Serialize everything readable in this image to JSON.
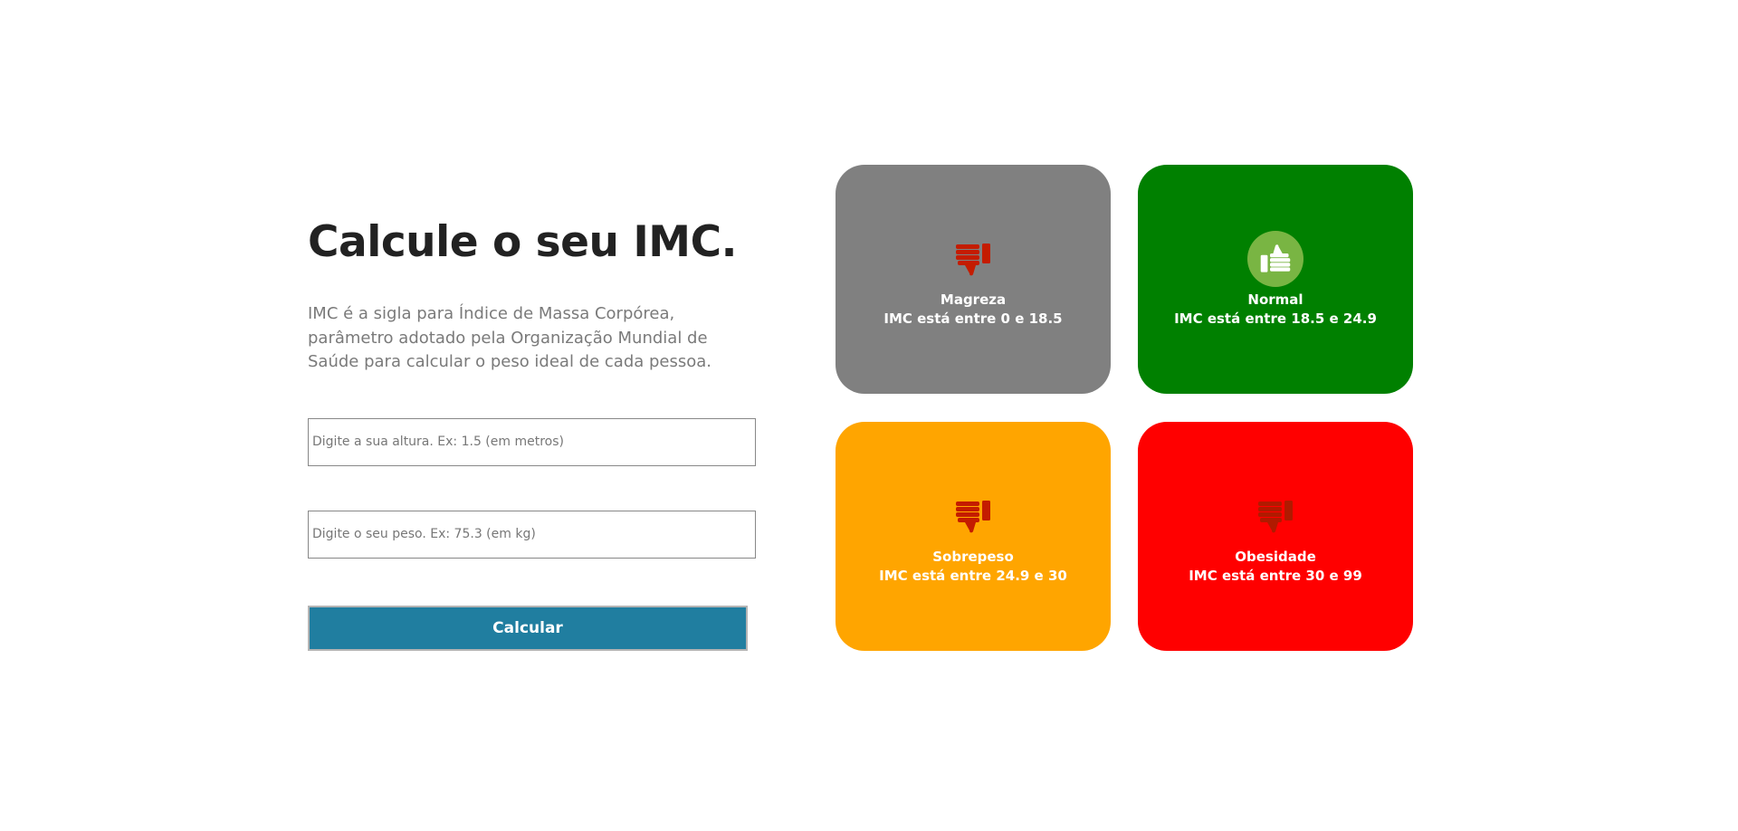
{
  "header": {
    "title": "Calcule o seu IMC.",
    "description": "IMC é a sigla para Índice de Massa Corpórea, parâmetro adotado pela Organização Mundial de Saúde para calcular o peso ideal de cada pessoa."
  },
  "form": {
    "altura_placeholder": "Digite a sua altura. Ex: 1.5 (em metros)",
    "altura_value": "",
    "peso_placeholder": "Digite o seu peso. Ex: 75.3 (em kg)",
    "peso_value": "",
    "calcular_label": "Calcular"
  },
  "cards": [
    {
      "label": "Magreza",
      "range": "IMC está entre 0 e 18.5",
      "icon": "thumbs-down-icon",
      "bg_color": "#808080",
      "icon_color": "#c41c00",
      "active": false
    },
    {
      "label": "Normal",
      "range": "IMC está entre 18.5 e 24.9",
      "icon": "thumbs-up-icon",
      "bg_color": "#008000",
      "icon_color": "#ffffff",
      "icon_bg_color": "#79b543",
      "active": true
    },
    {
      "label": "Sobrepeso",
      "range": "IMC está entre 24.9 e 30",
      "icon": "thumbs-down-icon",
      "bg_color": "#ffa500",
      "icon_color": "#c41c00",
      "active": false
    },
    {
      "label": "Obesidade",
      "range": "IMC está entre 30 e 99",
      "icon": "thumbs-down-icon",
      "bg_color": "#ff0000",
      "icon_color": "#b01a00",
      "active": false
    }
  ]
}
